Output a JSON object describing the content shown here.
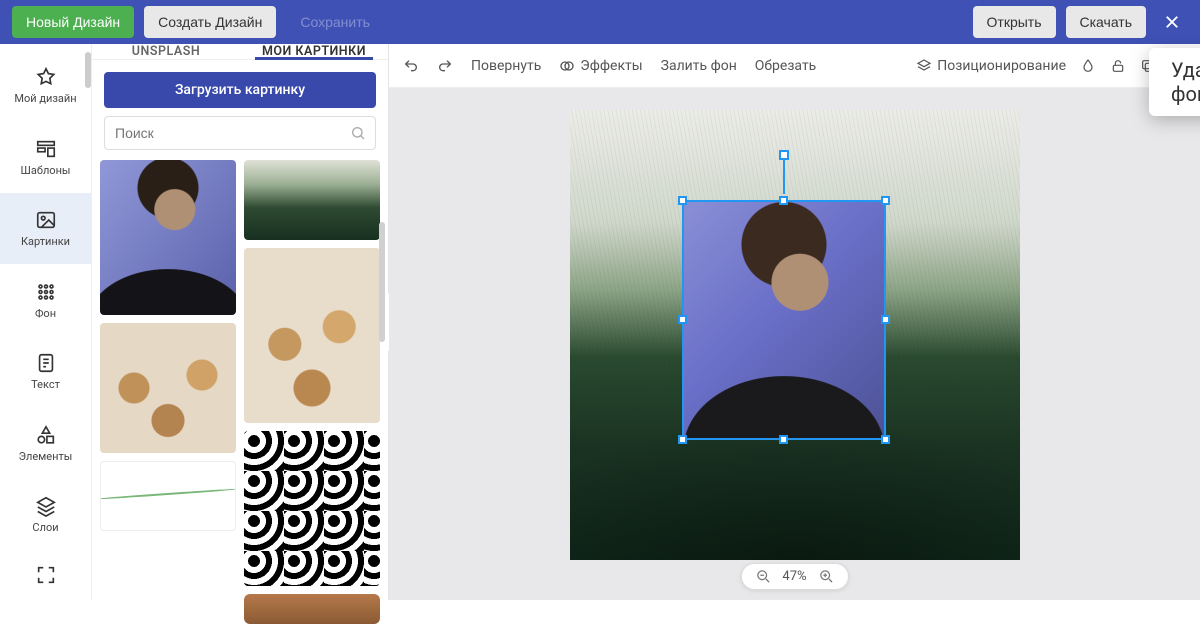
{
  "topbar": {
    "new_design": "Новый Дизайн",
    "create_design": "Создать Дизайн",
    "save": "Сохранить",
    "open": "Открыть",
    "download": "Скачать"
  },
  "rail": {
    "my_design": "Мой дизайн",
    "templates": "Шаблоны",
    "images": "Картинки",
    "background": "Фон",
    "text": "Текст",
    "elements": "Элементы",
    "layers": "Слои"
  },
  "panel": {
    "tab_unsplash": "UNSPLASH",
    "tab_my_images": "МОИ КАРТИНКИ",
    "upload": "Загрузить картинку",
    "search_placeholder": "Поиск"
  },
  "toolbar": {
    "rotate": "Повернуть",
    "effects": "Эффекты",
    "fill_bg": "Залить фон",
    "crop": "Обрезать",
    "positioning": "Позиционирование",
    "popover": "Удалить фон"
  },
  "zoom": {
    "value": "47%"
  }
}
